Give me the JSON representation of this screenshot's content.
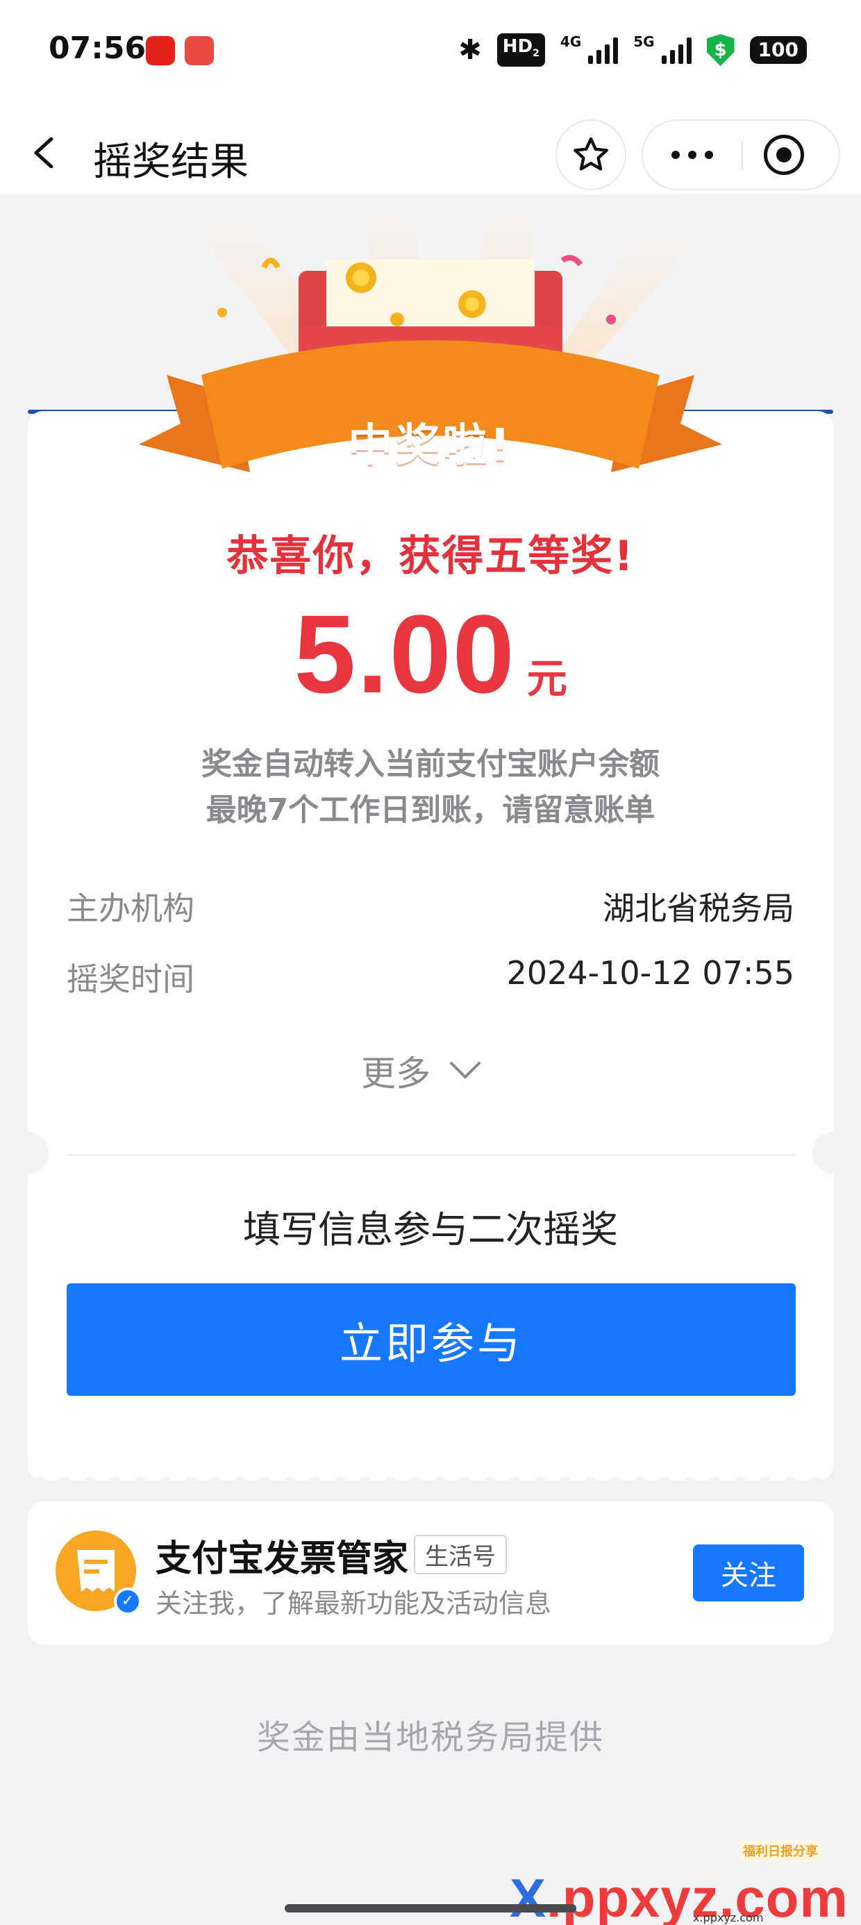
{
  "status_bar": {
    "time": "07:56",
    "network_badge": "HD",
    "network_sub": "2",
    "net_4g": "4G",
    "net_5g": "5G",
    "battery": "100",
    "shield_glyph": "$"
  },
  "nav": {
    "title": "摇奖结果"
  },
  "prize": {
    "ribbon_text": "中奖啦!",
    "congrats": "恭喜你，获得五等奖!",
    "amount": "5.00",
    "unit": "元",
    "note_line1": "奖金自动转入当前支付宝账户余额",
    "note_line2": "最晚7个工作日到账，请留意账单"
  },
  "details": [
    {
      "label": "主办机构",
      "value": "湖北省税务局"
    },
    {
      "label": "摇奖时间",
      "value": "2024-10-12 07:55"
    }
  ],
  "more_label": "更多",
  "second_draw": {
    "title": "填写信息参与二次摇奖",
    "button_label": "立即参与"
  },
  "account": {
    "name": "支付宝发票管家",
    "tag": "生活号",
    "description": "关注我，了解最新功能及活动信息",
    "follow_label": "关注",
    "verified_glyph": "✓"
  },
  "footer_note": "奖金由当地税务局提供",
  "watermark": {
    "text_x": "X",
    "text_rest": ".ppxyz.com",
    "sub": "x.ppxyz.com",
    "badge": "福利日报分享"
  },
  "colors": {
    "accent_blue": "#1677ff",
    "prize_red": "#e8363f",
    "ribbon_orange": "#f28a1c",
    "envelope_red": "#e04646"
  }
}
